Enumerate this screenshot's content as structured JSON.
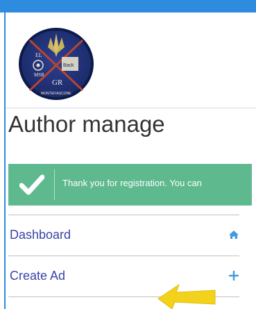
{
  "colors": {
    "top_bar": "#2d8be0",
    "alert_background": "#5fb98e",
    "menu_link": "#3a44a8",
    "title_text": "#333333"
  },
  "logo": {
    "icon": "organization-seal-logo",
    "lettering": [
      "EL",
      "MSR",
      "Back",
      "GR",
      "MONTEFIASCONE"
    ]
  },
  "page": {
    "title": "Author manage"
  },
  "alert": {
    "icon": "check-icon",
    "message": "Thank you for registration. You can"
  },
  "menu": {
    "items": [
      {
        "label": "Dashboard",
        "icon": "home-icon"
      },
      {
        "label": "Create Ad",
        "icon": "plus-icon"
      }
    ]
  },
  "annotation": {
    "icon": "highlight-arrow-icon",
    "color": "#f2d21a"
  }
}
